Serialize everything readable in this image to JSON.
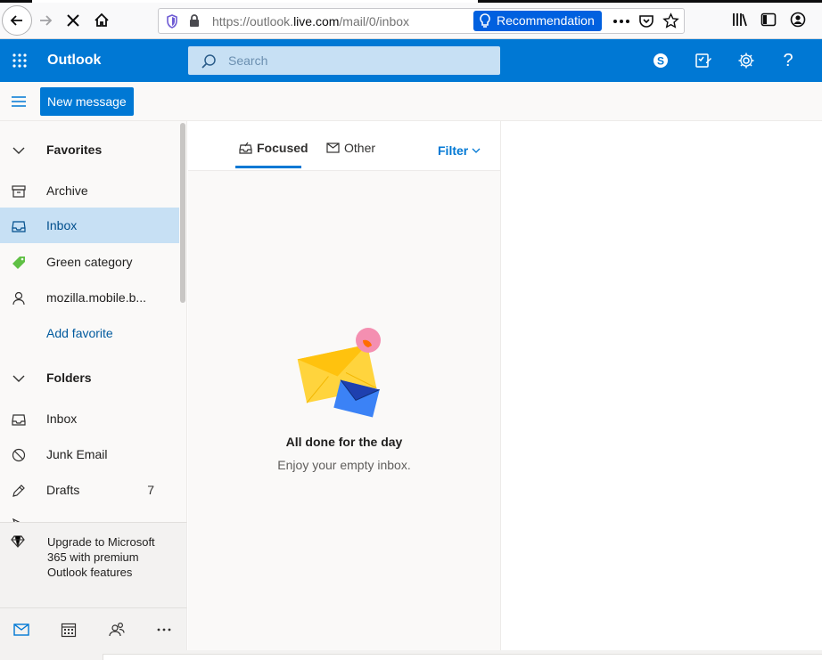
{
  "browser": {
    "url_prefix": "https://outlook.",
    "url_host": "live.com",
    "url_suffix": "/mail/0/inbox",
    "recommendation_label": "Recommendation"
  },
  "header": {
    "app_name": "Outlook",
    "search_placeholder": "Search",
    "help_label": "?"
  },
  "commandbar": {
    "new_message_label": "New message"
  },
  "sidebar": {
    "favorites_label": "Favorites",
    "favorites": [
      {
        "label": "Archive",
        "icon": "archive-icon"
      },
      {
        "label": "Inbox",
        "icon": "inbox-icon",
        "selected": true
      },
      {
        "label": "Green category",
        "icon": "tag-icon"
      },
      {
        "label": "mozilla.mobile.b...",
        "icon": "person-icon"
      }
    ],
    "add_favorite_label": "Add favorite",
    "folders_label": "Folders",
    "folders": [
      {
        "label": "Inbox",
        "icon": "inbox-icon"
      },
      {
        "label": "Junk Email",
        "icon": "blocked-icon"
      },
      {
        "label": "Drafts",
        "icon": "pencil-icon",
        "count": "7"
      }
    ],
    "upgrade_text": "Upgrade to Microsoft 365 with premium Outlook features"
  },
  "msglist": {
    "tab_focused": "Focused",
    "tab_other": "Other",
    "filter_label": "Filter",
    "empty_title": "All done for the day",
    "empty_subtitle": "Enjoy your empty inbox."
  },
  "colors": {
    "brand_blue": "#0078d4",
    "selected_bg": "#c7e0f4",
    "search_bg": "#c7e0f4",
    "recommend_bg": "#0060df"
  }
}
